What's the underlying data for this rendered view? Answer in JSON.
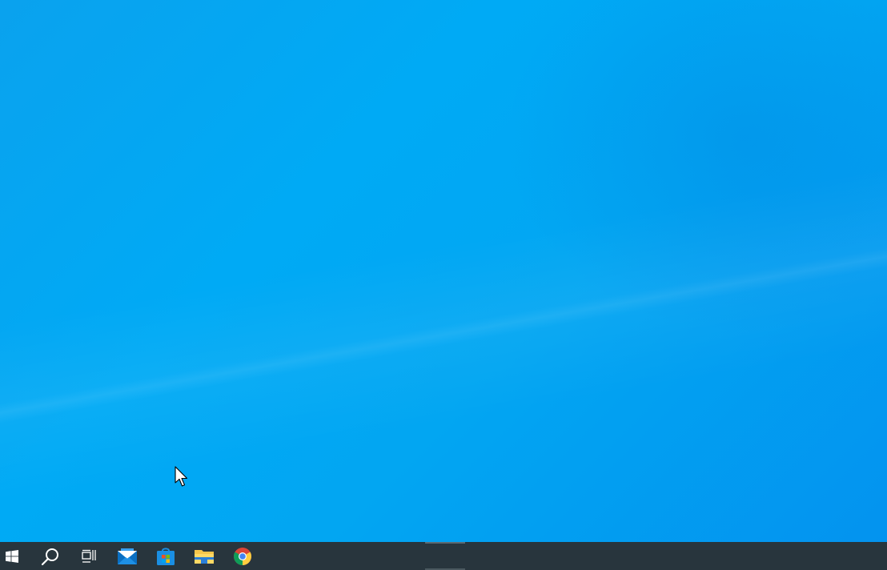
{
  "desktop": {
    "wallpaper": "windows-10-light-blue",
    "background_color": "#00aaf5"
  },
  "cursor": {
    "icon": "arrow-cursor-icon"
  },
  "taskbar": {
    "background_color": "#28353d",
    "items": [
      {
        "name": "start-button",
        "icon": "windows-logo-icon"
      },
      {
        "name": "search-button",
        "icon": "search-icon"
      },
      {
        "name": "task-view-button",
        "icon": "task-view-icon"
      },
      {
        "name": "mail-app",
        "icon": "mail-icon"
      },
      {
        "name": "microsoft-store-app",
        "icon": "store-icon"
      },
      {
        "name": "file-explorer-app",
        "icon": "folder-icon"
      },
      {
        "name": "chrome-app",
        "icon": "chrome-icon"
      }
    ]
  }
}
